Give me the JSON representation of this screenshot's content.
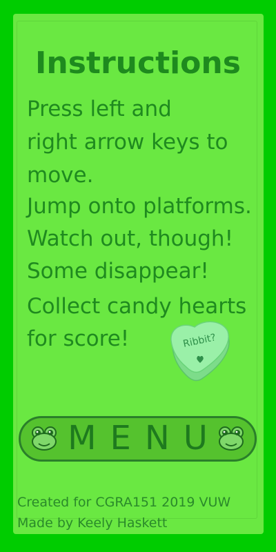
{
  "title": "Instructions",
  "instructions": [
    "Press left and",
    "right arrow keys to",
    "move.",
    "Jump onto platforms.",
    "Watch out, though!",
    "Some disappear!",
    "Collect candy hearts",
    "for score!"
  ],
  "candy_heart": {
    "text": "Ribbit?",
    "icon": "candy-heart-icon"
  },
  "menu_button": {
    "label": "MENU",
    "icon": "frog-face-icon"
  },
  "credits": {
    "line1": "Created for CGRA151 2019 VUW",
    "line2": "Made by Keely Haskett"
  },
  "colors": {
    "background": "#00cc00",
    "panel": "#6ae842",
    "text": "#1f8a1f",
    "button": "#55c22e",
    "button_border": "#2a7f2a",
    "heart": "#9af0a8"
  }
}
